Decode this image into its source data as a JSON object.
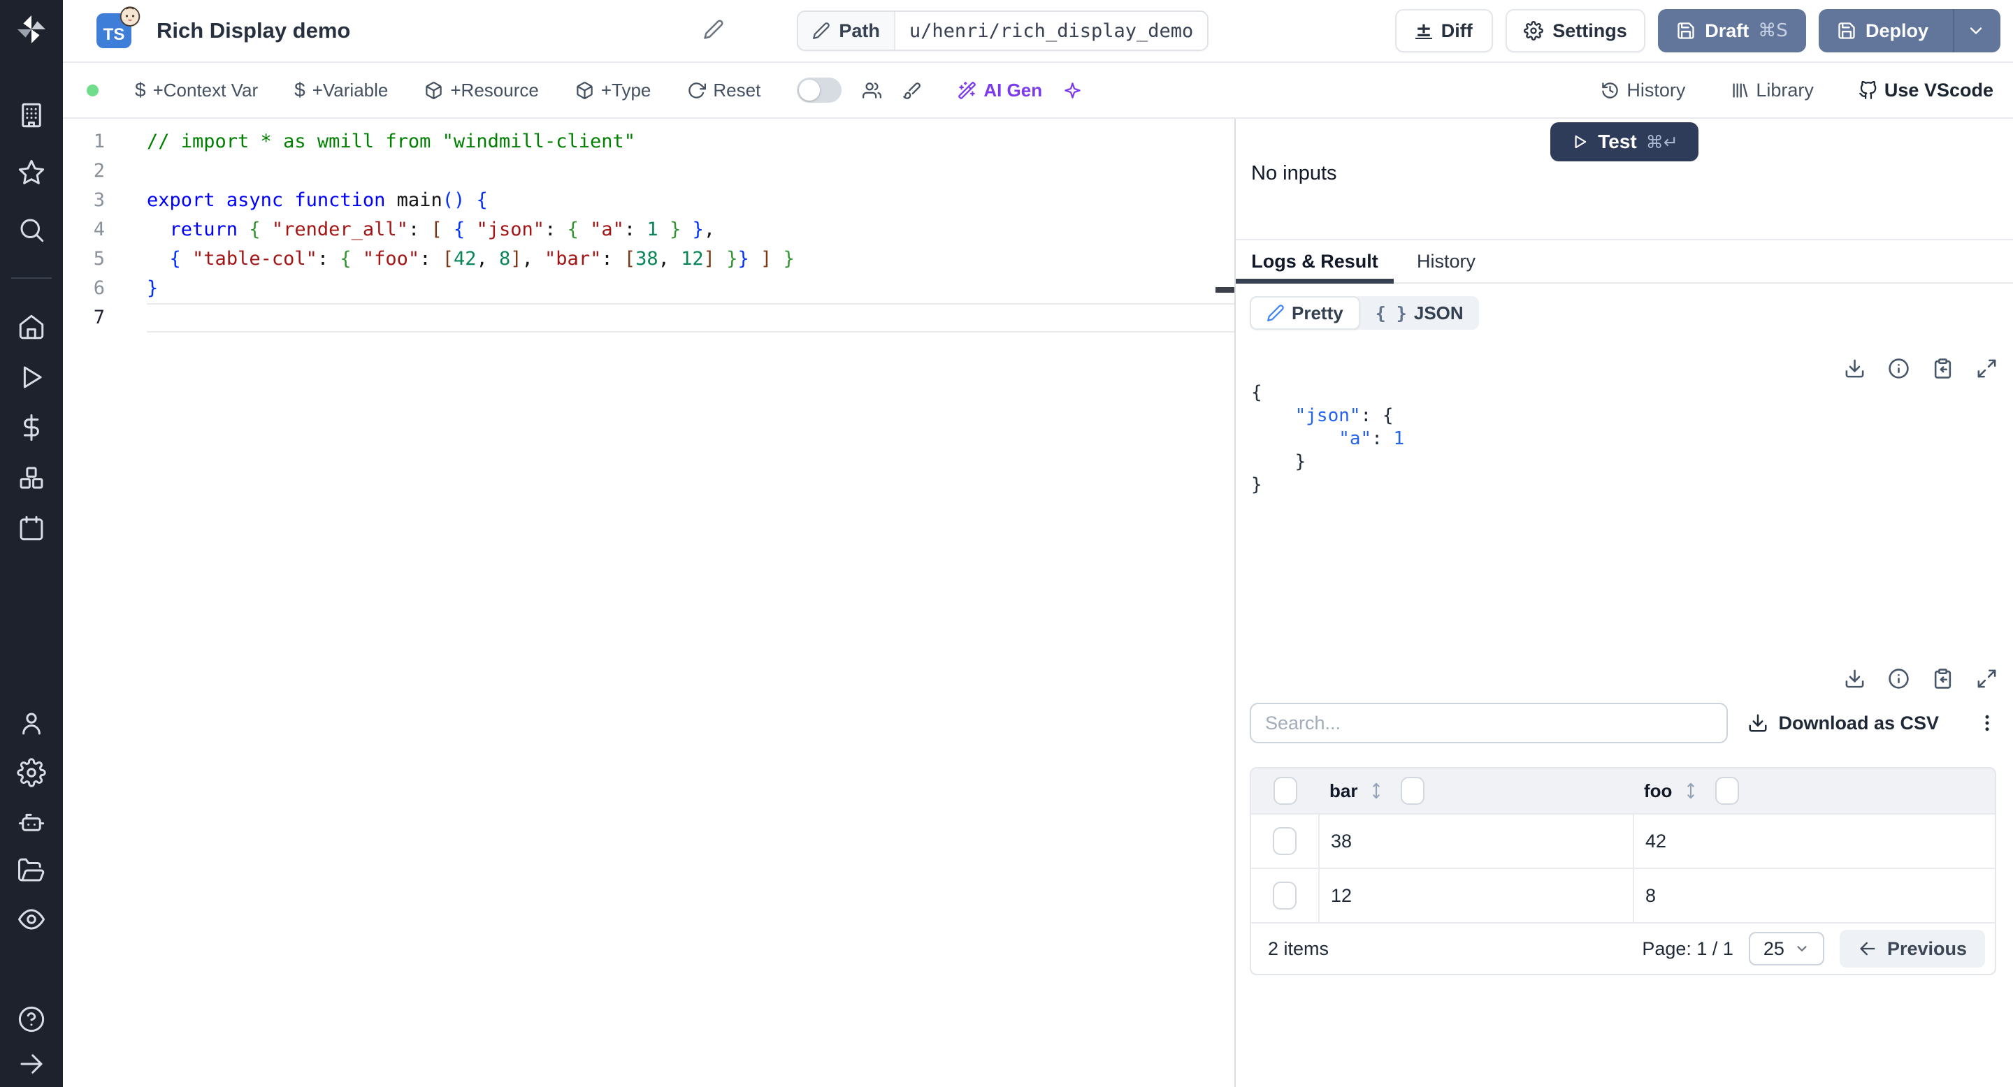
{
  "header": {
    "language_badge": "TS",
    "title": "Rich Display demo",
    "path_label": "Path",
    "path_value": "u/henri/rich_display_demo",
    "buttons": {
      "diff": "Diff",
      "settings": "Settings",
      "draft": "Draft",
      "draft_shortcut": "⌘S",
      "deploy": "Deploy"
    }
  },
  "toolbar": {
    "context_var": "+Context Var",
    "variable": "+Variable",
    "resource": "+Resource",
    "type": "+Type",
    "reset": "Reset",
    "ai_gen": "AI Gen",
    "history": "History",
    "library": "Library",
    "vscode": "Use VScode"
  },
  "editor": {
    "lines": [
      {
        "n": "1",
        "tokens": [
          [
            "c",
            "// import * as wmill from \"windmill-client\""
          ]
        ]
      },
      {
        "n": "2",
        "tokens": []
      },
      {
        "n": "3",
        "tokens": [
          [
            "k",
            "export"
          ],
          [
            "p",
            " "
          ],
          [
            "k",
            "async"
          ],
          [
            "p",
            " "
          ],
          [
            "k",
            "function"
          ],
          [
            "p",
            " "
          ],
          [
            "p",
            "main"
          ],
          [
            "b1",
            "()"
          ],
          [
            "p",
            " "
          ],
          [
            "b1",
            "{"
          ]
        ]
      },
      {
        "n": "4",
        "tokens": [
          [
            "p",
            "  "
          ],
          [
            "k",
            "return"
          ],
          [
            "p",
            " "
          ],
          [
            "b2",
            "{"
          ],
          [
            "p",
            " "
          ],
          [
            "s",
            "\"render_all\""
          ],
          [
            "p",
            ": "
          ],
          [
            "b3",
            "["
          ],
          [
            "p",
            " "
          ],
          [
            "b1",
            "{"
          ],
          [
            "p",
            " "
          ],
          [
            "s",
            "\"json\""
          ],
          [
            "p",
            ": "
          ],
          [
            "b2",
            "{"
          ],
          [
            "p",
            " "
          ],
          [
            "s",
            "\"a\""
          ],
          [
            "p",
            ": "
          ],
          [
            "n",
            "1"
          ],
          [
            "p",
            " "
          ],
          [
            "b2",
            "}"
          ],
          [
            "p",
            " "
          ],
          [
            "b1",
            "}"
          ],
          [
            "p",
            ","
          ]
        ]
      },
      {
        "n": "5",
        "tokens": [
          [
            "p",
            "  "
          ],
          [
            "b1",
            "{"
          ],
          [
            "p",
            " "
          ],
          [
            "s",
            "\"table-col\""
          ],
          [
            "p",
            ": "
          ],
          [
            "b2",
            "{"
          ],
          [
            "p",
            " "
          ],
          [
            "s",
            "\"foo\""
          ],
          [
            "p",
            ": "
          ],
          [
            "b3",
            "["
          ],
          [
            "n",
            "42"
          ],
          [
            "p",
            ", "
          ],
          [
            "n",
            "8"
          ],
          [
            "b3",
            "]"
          ],
          [
            "p",
            ", "
          ],
          [
            "s",
            "\"bar\""
          ],
          [
            "p",
            ": "
          ],
          [
            "b3",
            "["
          ],
          [
            "n",
            "38"
          ],
          [
            "p",
            ", "
          ],
          [
            "n",
            "12"
          ],
          [
            "b3",
            "]"
          ],
          [
            "p",
            " "
          ],
          [
            "b2",
            "}"
          ],
          [
            "b1",
            "}"
          ],
          [
            "p",
            " "
          ],
          [
            "b3",
            "]"
          ],
          [
            "p",
            " "
          ],
          [
            "b2",
            "}"
          ]
        ]
      },
      {
        "n": "6",
        "tokens": [
          [
            "b1",
            "}"
          ]
        ]
      },
      {
        "n": "7",
        "tokens": [],
        "active": true
      }
    ]
  },
  "run_panel": {
    "test_label": "Test",
    "test_shortcut": "⌘↵",
    "no_inputs": "No inputs"
  },
  "result_panel": {
    "tabs": {
      "logs": "Logs & Result",
      "history": "History"
    },
    "view_toggle": {
      "pretty": "Pretty",
      "json": "JSON",
      "json_icon": "{ }"
    },
    "json_lines": [
      [
        [
          "jp",
          "{"
        ]
      ],
      [
        [
          "jp",
          "    "
        ],
        [
          "jk",
          "\"json\""
        ],
        [
          "jp",
          ": "
        ],
        [
          "jp",
          "{"
        ]
      ],
      [
        [
          "jp",
          "        "
        ],
        [
          "jk",
          "\"a\""
        ],
        [
          "jp",
          ": "
        ],
        [
          "jn",
          "1"
        ]
      ],
      [
        [
          "jp",
          "    }"
        ]
      ],
      [
        [
          "jp",
          "}"
        ]
      ]
    ]
  },
  "result_table": {
    "search_placeholder": "Search...",
    "download_csv": "Download as CSV",
    "columns": [
      "bar",
      "foo"
    ],
    "rows": [
      {
        "bar": "38",
        "foo": "42"
      },
      {
        "bar": "12",
        "foo": "8"
      }
    ],
    "items_label": "2 items",
    "page_label": "Page: 1 / 1",
    "page_size": "25",
    "previous_label": "Previous"
  },
  "colors": {
    "sidebar_bg": "#1d222c",
    "slate_button": "#62769c",
    "test_button": "#2f3c59",
    "ai_accent": "#7c3aed",
    "status_green": "#6fdd8b",
    "ts_badge_blue": "#3f7ed8",
    "json_key_blue": "#2563eb"
  }
}
